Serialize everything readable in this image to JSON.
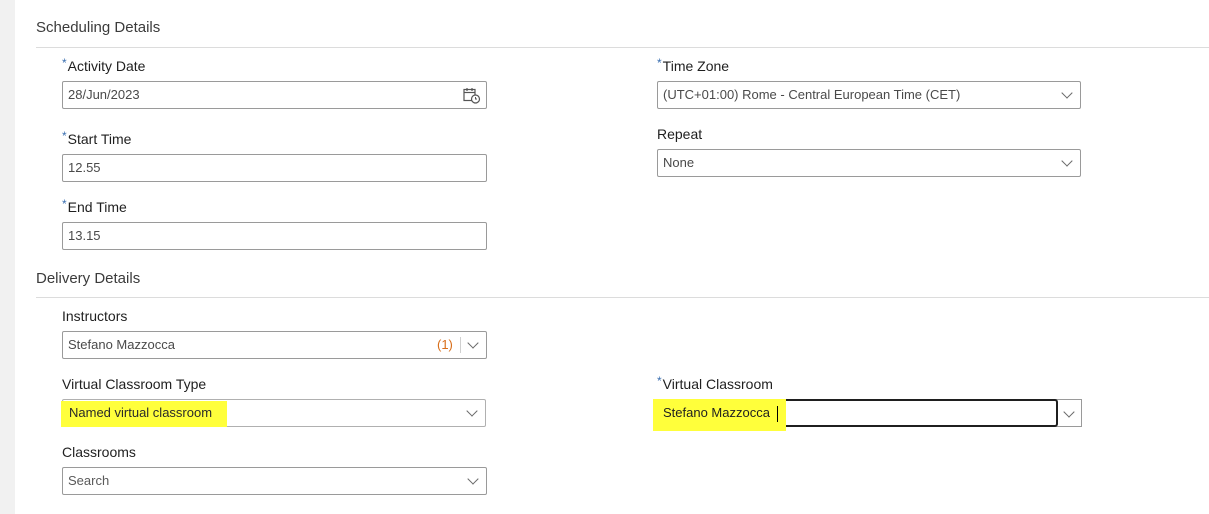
{
  "scheduling": {
    "title": "Scheduling Details",
    "activity_date": {
      "label": "Activity Date",
      "required": "*",
      "value": "28/Jun/2023"
    },
    "start_time": {
      "label": "Start Time",
      "required": "*",
      "value": "12.55"
    },
    "end_time": {
      "label": "End Time",
      "required": "*",
      "value": "13.15"
    },
    "time_zone": {
      "label": "Time Zone",
      "required": "*",
      "value": "(UTC+01:00) Rome - Central European Time (CET)"
    },
    "repeat": {
      "label": "Repeat",
      "value": "None"
    }
  },
  "delivery": {
    "title": "Delivery Details",
    "instructors": {
      "label": "Instructors",
      "value": "Stefano Mazzocca",
      "count": "(1)"
    },
    "vc_type": {
      "label": "Virtual Classroom Type",
      "value": "Named virtual classroom"
    },
    "virtual_classroom": {
      "label": "Virtual Classroom",
      "required": "*",
      "value": "Stefano Mazzocca"
    },
    "classrooms": {
      "label": "Classrooms",
      "placeholder": "Search"
    }
  },
  "colors": {
    "highlight": "#ffff3b",
    "required_marker": "#3a6fb0",
    "count": "#d86e1a"
  },
  "icons": {
    "calendar": "calendar-clock-icon",
    "dropdown": "chevron-down-icon"
  }
}
